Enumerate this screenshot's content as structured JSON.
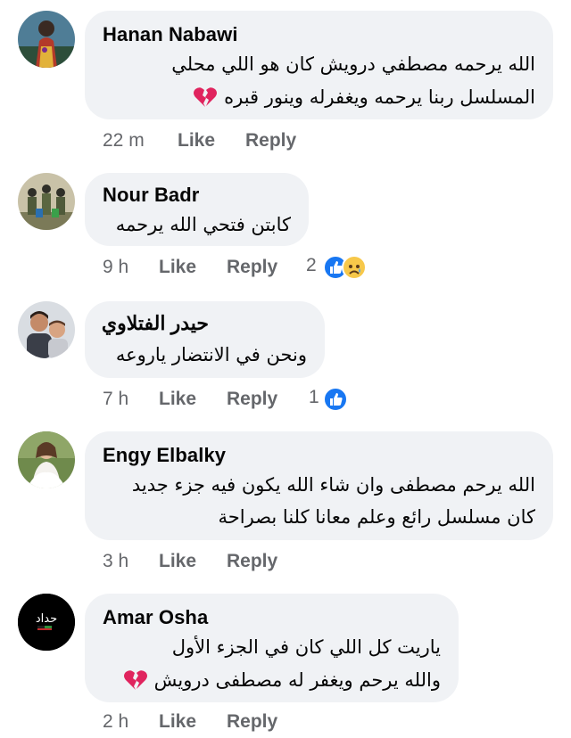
{
  "comments": [
    {
      "author": "Hanan Nabawi",
      "lines": [
        "الله يرحمه مصطفي درويش كان هو اللي محلي",
        "المسلسل ربنا يرحمه ويغفرله وينور قبره"
      ],
      "time": "22 m",
      "like_label": "Like",
      "reply_label": "Reply",
      "reaction_count": "",
      "ends_with_icon": "broken-heart-icon"
    },
    {
      "author": "Nour Badr",
      "lines": [
        "كابتن فتحي الله يرحمه"
      ],
      "time": "9 h",
      "like_label": "Like",
      "reply_label": "Reply",
      "reaction_count": "2",
      "reactions": [
        "like-icon",
        "sad-icon"
      ]
    },
    {
      "author": "حيدر الفتلاوي",
      "lines": [
        "ونحن في الانتضار ياروعه"
      ],
      "time": "7 h",
      "like_label": "Like",
      "reply_label": "Reply",
      "reaction_count": "1",
      "reactions": [
        "like-icon"
      ]
    },
    {
      "author": "Engy Elbalky",
      "lines": [
        "الله يرحم مصطفى وان شاء الله يكون فيه جزء جديد",
        "كان مسلسل رائع وعلم معانا كلنا بصراحة"
      ],
      "time": "3 h",
      "like_label": "Like",
      "reply_label": "Reply",
      "reaction_count": ""
    },
    {
      "author": "Amar Osha",
      "avatar_text": "حداد",
      "lines": [
        "ياريت كل اللي كان في الجزء الأول",
        "والله يرحم ويغفر له مصطفى درويش"
      ],
      "time": "2 h",
      "like_label": "Like",
      "reply_label": "Reply",
      "reaction_count": "",
      "ends_with_icon": "broken-heart-icon"
    }
  ],
  "colors": {
    "bubble": "#f0f2f5",
    "meta_text": "#65676b",
    "like_blue": "#1877f2",
    "heart_red": "#e0245e"
  }
}
